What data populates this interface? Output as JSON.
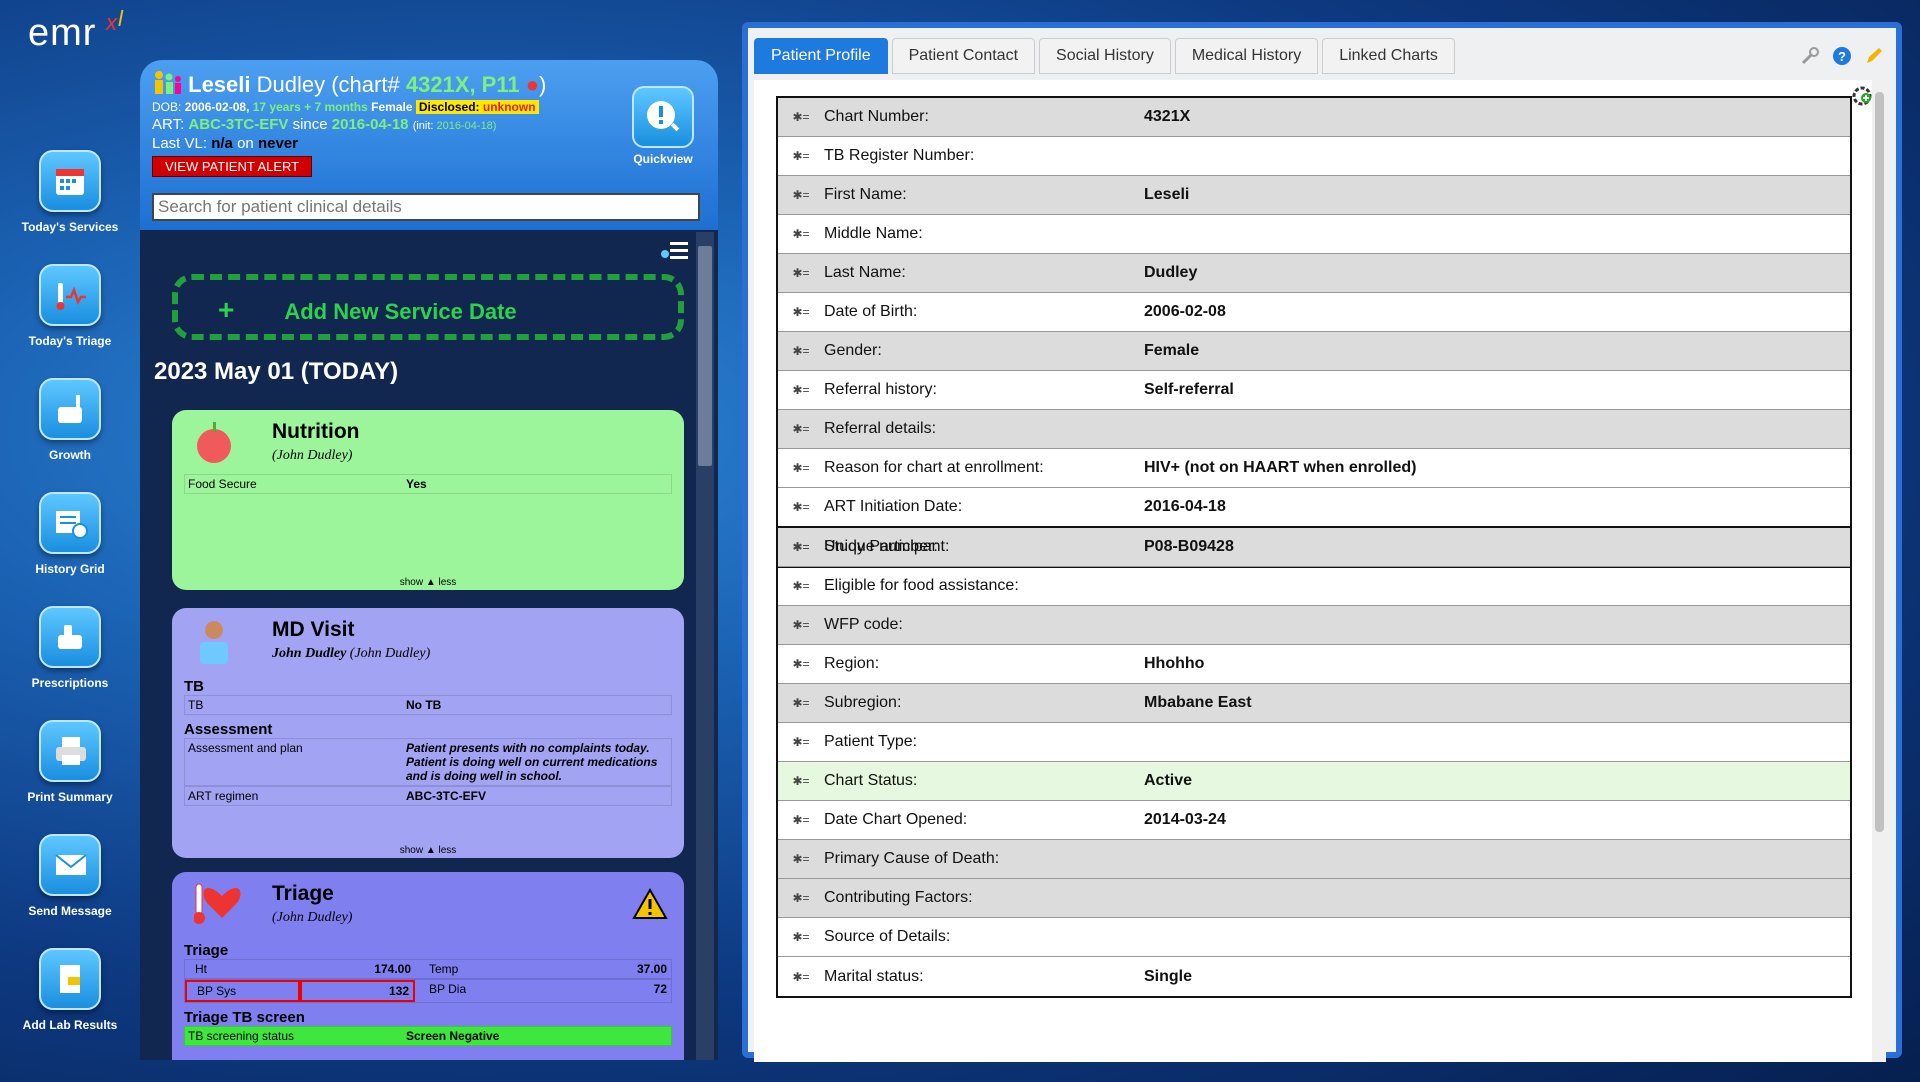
{
  "logo": {
    "text": "emr",
    "mark": "x",
    "mark2": "l"
  },
  "nav": [
    {
      "label": "Today's Services",
      "icon": "calendar-icon"
    },
    {
      "label": "Today's Triage",
      "icon": "thermometer-heart-icon"
    },
    {
      "label": "Growth",
      "icon": "scale-icon"
    },
    {
      "label": "History Grid",
      "icon": "history-grid-icon"
    },
    {
      "label": "Prescriptions",
      "icon": "prescription-icon"
    },
    {
      "label": "Print Summary",
      "icon": "printer-icon"
    },
    {
      "label": "Send Message",
      "icon": "envelope-icon"
    },
    {
      "label": "Add Lab Results",
      "icon": "lab-results-icon"
    }
  ],
  "patient": {
    "first": "Leseli",
    "last": "Dudley",
    "chart_prefix": "(chart#",
    "chart": "4321X, P11",
    "chart_suffix": ")",
    "dob_label": "DOB:",
    "dob": "2006-02-08,",
    "age": "17 years + 7 months",
    "gender": "Female",
    "disclosed_label": "Disclosed:",
    "disclosed": "unknown",
    "art_label": "ART:",
    "art": "ABC-3TC-EFV",
    "since_label": "since",
    "since": "2016-04-18",
    "init_label": "(init:",
    "init": "2016-04-18)",
    "vl_label": "Last VL:",
    "vl": "n/a",
    "on_label": "on",
    "vl_date": "never",
    "alert_btn": "VIEW PATIENT ALERT",
    "quickview": "Quickview"
  },
  "search": {
    "placeholder": "Search for patient clinical details"
  },
  "add_service": {
    "plus": "+",
    "label": "Add New Service Date"
  },
  "date_heading": "2023  May 01 (TODAY)",
  "nutrition": {
    "title": "Nutrition",
    "by": "(John Dudley)",
    "rows": [
      [
        "Food Secure",
        "Yes"
      ]
    ],
    "show": "show ▲ less"
  },
  "mdvisit": {
    "title": "MD Visit",
    "by_main": "John Dudley",
    "by": "(John Dudley)",
    "sec1": "TB",
    "rows1": [
      [
        "TB",
        "No TB"
      ]
    ],
    "sec2": "Assessment",
    "rows2": [
      [
        "Assessment and plan",
        "Patient presents with no complaints today. Patient is doing well on current medications and is doing well in school."
      ],
      [
        "ART regimen",
        "ABC-3TC-EFV"
      ]
    ],
    "show": "show ▲ less"
  },
  "triage": {
    "title": "Triage",
    "by": "(John Dudley)",
    "sec1": "Triage",
    "vitals": [
      [
        "Ht",
        "174.00",
        "Temp",
        "37.00"
      ],
      [
        "BP Sys",
        "132",
        "BP Dia",
        "72"
      ]
    ],
    "sec2": "Triage TB screen",
    "tb_label": "TB screening status",
    "tb_value": "Screen Negative"
  },
  "tabs": [
    "Patient Profile",
    "Patient Contact",
    "Social History",
    "Medical History",
    "Linked Charts"
  ],
  "profile1": [
    [
      "Chart Number:",
      "4321X"
    ],
    [
      "TB Register Number:",
      ""
    ],
    [
      "First Name:",
      "Leseli"
    ],
    [
      "Middle Name:",
      ""
    ],
    [
      "Last Name:",
      "Dudley"
    ],
    [
      "Date of Birth:",
      "2006-02-08"
    ],
    [
      "Gender:",
      "Female"
    ],
    [
      "Referral history:",
      "Self-referral"
    ],
    [
      "Referral details:",
      ""
    ],
    [
      "Reason for chart at enrollment:",
      "HIV+ (not on HAART when enrolled)"
    ],
    [
      "ART Initiation Date:",
      "2016-04-18"
    ],
    [
      "Unique number:",
      "P08-B09428"
    ]
  ],
  "profile2": [
    [
      "Study Participant:",
      ""
    ],
    [
      "Eligible for food assistance:",
      ""
    ],
    [
      "WFP code:",
      ""
    ],
    [
      "Region:",
      "Hhohho"
    ],
    [
      "Subregion:",
      "Mbabane East"
    ],
    [
      "Patient Type:",
      ""
    ],
    [
      "Chart Status:",
      "Active"
    ],
    [
      "Date Chart Opened:",
      "2014-03-24"
    ],
    [
      "Primary Cause of Death:",
      ""
    ],
    [
      "Contributing Factors:",
      ""
    ],
    [
      "Source of Details:",
      ""
    ],
    [
      "Marital status:",
      "Single"
    ]
  ],
  "row_handle": "✱="
}
